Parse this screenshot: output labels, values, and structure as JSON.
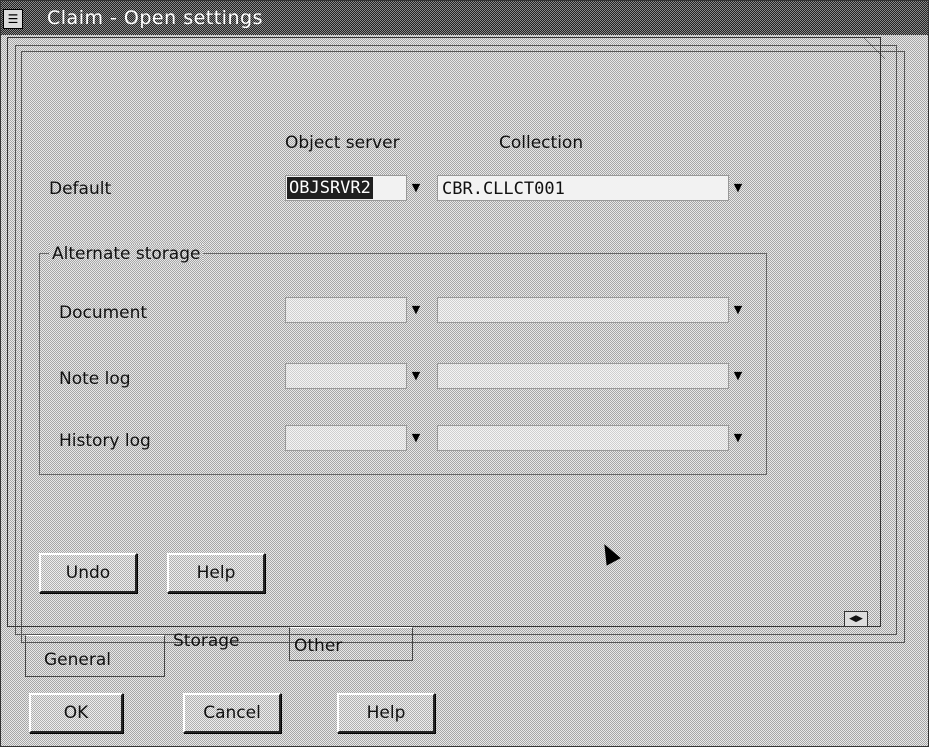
{
  "window": {
    "title": "Claim - Open settings",
    "system_menu_icon": "system-menu-icon"
  },
  "columns": {
    "object_server": "Object server",
    "collection": "Collection"
  },
  "default_row": {
    "label": "Default",
    "object_server_value": "OBJSRVR2",
    "collection_value": "CBR.CLLCT001"
  },
  "alternate_storage": {
    "label": "Alternate storage",
    "rows": [
      {
        "label": "Document"
      },
      {
        "label": "Note log"
      },
      {
        "label": "History log"
      }
    ]
  },
  "page_buttons": {
    "undo": "Undo",
    "help": "Help"
  },
  "tabs": {
    "general": "General",
    "storage": "Storage",
    "other": "Other",
    "active": "Storage"
  },
  "pager_icon": "page-arrows-icon",
  "dialog_buttons": {
    "ok": "OK",
    "cancel": "Cancel",
    "help": "Help"
  }
}
